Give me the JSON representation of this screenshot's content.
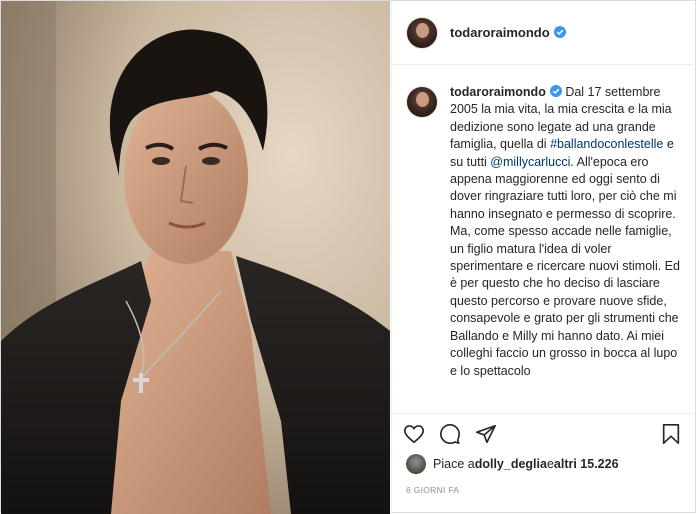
{
  "post": {
    "username": "todaroraimondo",
    "verified_icon": "verified-badge-icon",
    "caption_paragraphs": [
      [
        {
          "t": "Dal 17 settembre 2005 la mia vita, la mia crescita e la mia dedizione sono legate ad una grande famiglia, quella di "
        },
        {
          "t": "#ballandoconlestelle",
          "link": true
        },
        {
          "t": " e su tutti "
        },
        {
          "t": "@millycarlucci",
          "link": true
        },
        {
          "t": ". All'epoca ero appena maggiorenne ed oggi sento di dover ringraziare tutti loro, per ciò che mi hanno insegnato e permesso di scoprire."
        }
      ],
      [
        {
          "t": "Ma, come spesso accade nelle famiglie, un figlio matura l'idea di voler sperimentare e ricercare nuovi stimoli. Ed è per questo che ho deciso di lasciare questo percorso e provare nuove sfide, consapevole e grato per gli strumenti che Ballando e Milly mi hanno dato. Ai miei colleghi faccio un grosso in bocca al lupo e lo spettacolo"
        }
      ]
    ]
  },
  "actions": {
    "icons": [
      "heart-icon",
      "comment-icon",
      "share-icon",
      "bookmark-icon"
    ]
  },
  "likes": {
    "prefix": "Piace a ",
    "user": "dolly_deglia",
    "middle": " e ",
    "others": "altri 15.226"
  },
  "timestamp": "6 GIORNI FA",
  "colors": {
    "link": "#00376b",
    "verified": "#3897f0",
    "text": "#262626",
    "muted": "#8e8e8e"
  }
}
